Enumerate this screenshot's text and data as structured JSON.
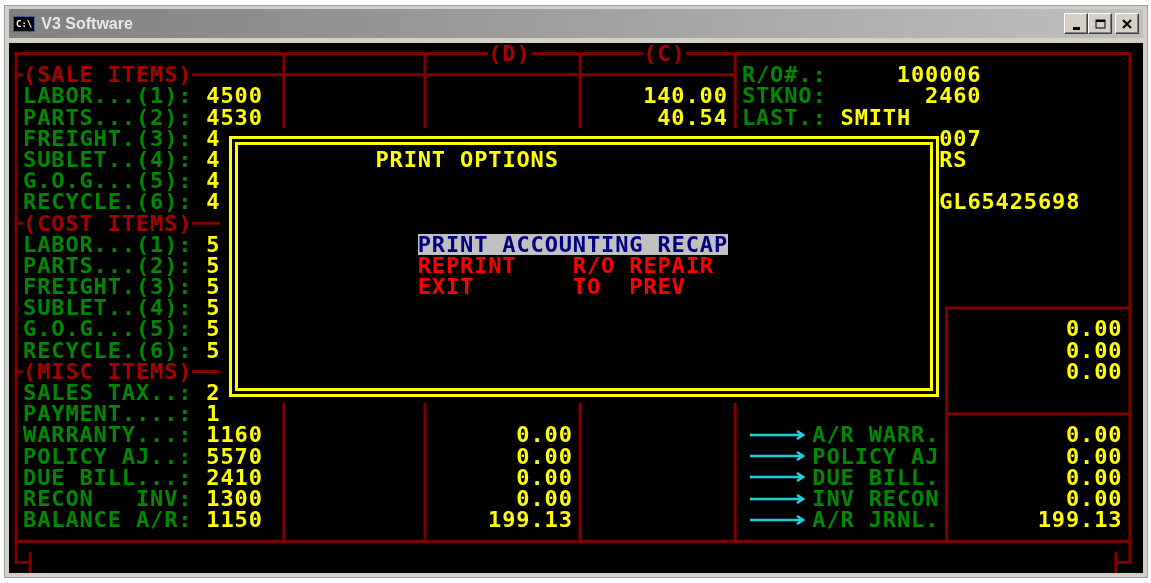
{
  "window": {
    "icon_text": "C:\\",
    "title": "V3 Software"
  },
  "column_headers": [
    "(D)",
    "(C)"
  ],
  "sale_items": {
    "heading": "(SALE ITEMS)",
    "rows": [
      {
        "label": "LABOR...(1):",
        "value": "4500"
      },
      {
        "label": "PARTS...(2):",
        "value": "4530"
      },
      {
        "label": "FREIGHT.(3):",
        "value": "4"
      },
      {
        "label": "SUBLET..(4):",
        "value": "4"
      },
      {
        "label": "G.O.G...(5):",
        "value": "4"
      },
      {
        "label": "RECYCLE.(6):",
        "value": "4"
      }
    ]
  },
  "cost_items": {
    "heading": "(COST ITEMS)",
    "rows": [
      {
        "label": "LABOR...(1):",
        "value": "5"
      },
      {
        "label": "PARTS...(2):",
        "value": "5"
      },
      {
        "label": "FREIGHT.(3):",
        "value": "5"
      },
      {
        "label": "SUBLET..(4):",
        "value": "5"
      },
      {
        "label": "G.O.G...(5):",
        "value": "5"
      },
      {
        "label": "RECYCLE.(6):",
        "value": "5"
      }
    ]
  },
  "misc_items": {
    "heading": "(MISC ITEMS)",
    "rows": [
      {
        "label": "SALES TAX..:",
        "value": "2"
      },
      {
        "label": "PAYMENT....:",
        "value": "1"
      },
      {
        "label": "WARRANTY...:",
        "value": "1160"
      },
      {
        "label": "POLICY AJ..:",
        "value": "5570"
      },
      {
        "label": "DUE BILL...:",
        "value": "2410"
      },
      {
        "label": "RECON   INV:",
        "value": "1300"
      },
      {
        "label": "BALANCE A/R:",
        "value": "1150"
      }
    ]
  },
  "column_c_amounts": [
    "140.00",
    "40.54"
  ],
  "column_d_amounts": [
    "0.00",
    "0.00",
    "0.00",
    "0.00",
    "199.13"
  ],
  "header_fields": [
    {
      "label": "R/O#.:",
      "value": "100006"
    },
    {
      "label": "STKNO:",
      "value": "2460"
    },
    {
      "label": "LAST.:",
      "value": "SMITH"
    }
  ],
  "partial_fields": [
    "007",
    "RS",
    "GL65425698"
  ],
  "upper_totals": [
    "0.00",
    "0.00",
    "0.00"
  ],
  "postings": [
    {
      "label": "A/R WARR.",
      "amount": "0.00"
    },
    {
      "label": "POLICY AJ",
      "amount": "0.00"
    },
    {
      "label": "DUE BILL.",
      "amount": "0.00"
    },
    {
      "label": "INV RECON",
      "amount": "0.00"
    },
    {
      "label": "A/R JRNL.",
      "amount": "199.13"
    }
  ],
  "dialog": {
    "title": "PRINT OPTIONS",
    "options": [
      {
        "label": "PRINT ACCOUNTING RECAP",
        "selected": true
      },
      {
        "label": "REPRINT    R/O REPAIR",
        "selected": false
      },
      {
        "label": "EXIT       TO  PREV",
        "selected": false
      }
    ]
  }
}
